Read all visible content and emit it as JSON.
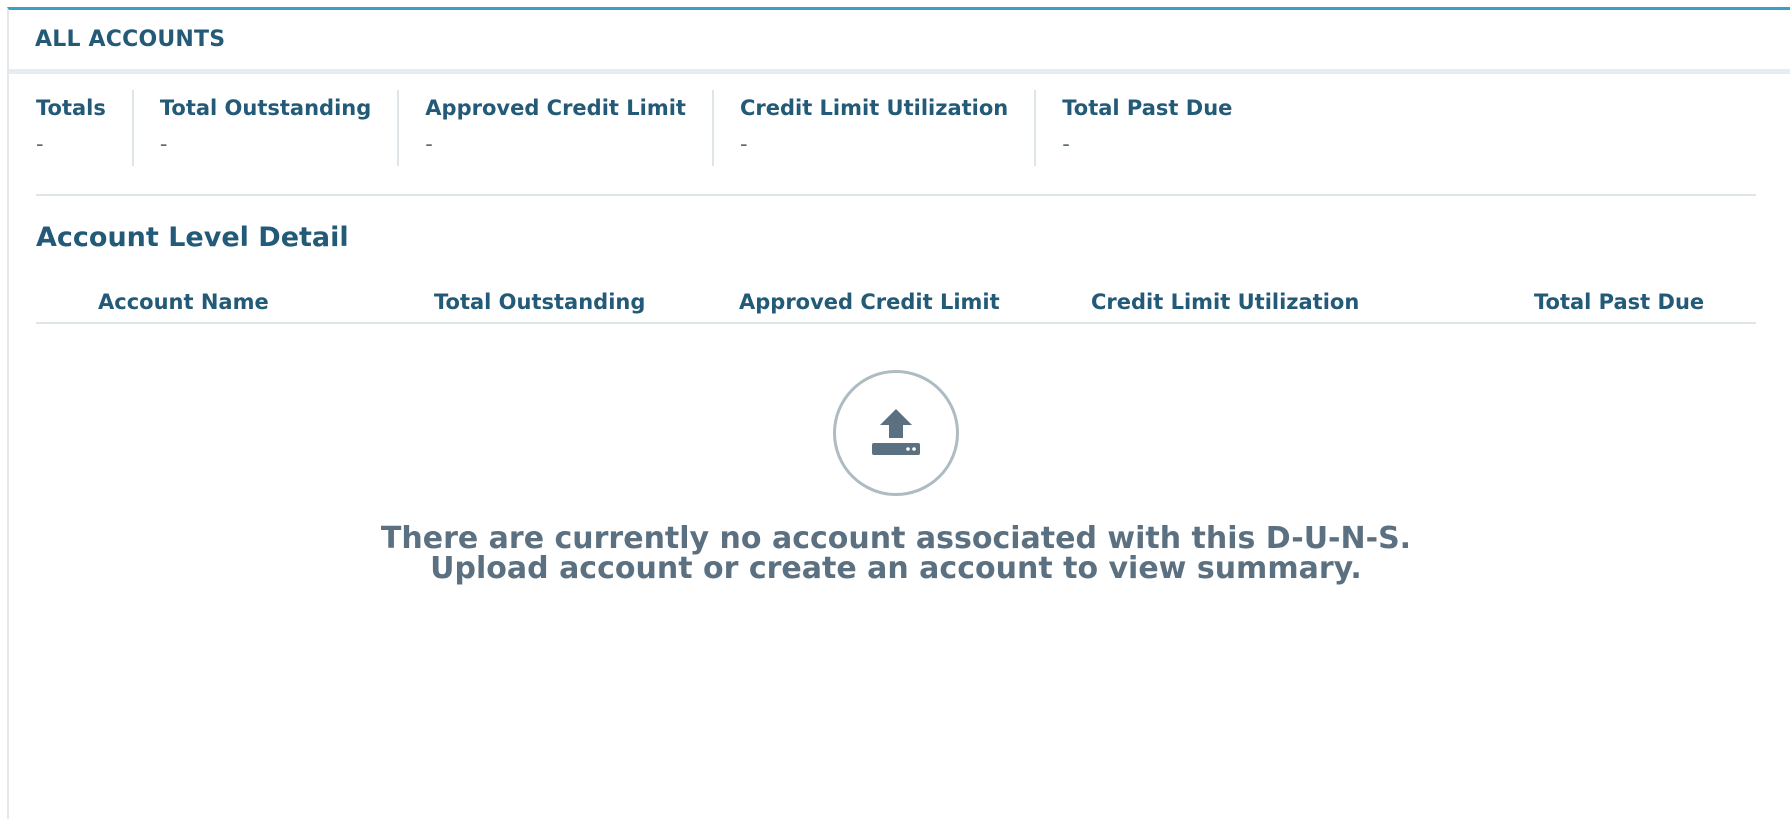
{
  "panel": {
    "title": "ALL ACCOUNTS"
  },
  "totals": [
    {
      "label": "Totals",
      "value": "-"
    },
    {
      "label": "Total Outstanding",
      "value": "-"
    },
    {
      "label": "Approved Credit Limit",
      "value": "-"
    },
    {
      "label": "Credit Limit Utilization",
      "value": "-"
    },
    {
      "label": "Total Past Due",
      "value": "-"
    }
  ],
  "detail": {
    "title": "Account Level Detail",
    "columns": [
      "Account Name",
      "Total Outstanding",
      "Approved Credit Limit",
      "Credit Limit Utilization",
      "Total Past Due"
    ]
  },
  "empty_state": {
    "icon": "upload-tray-icon",
    "line1": "There are currently no account associated with this D-U-N-S.",
    "line2": "Upload account or create an account to view summary."
  },
  "colors": {
    "accent": "#3aa0c8",
    "heading": "#235a78",
    "muted": "#5b7080"
  }
}
